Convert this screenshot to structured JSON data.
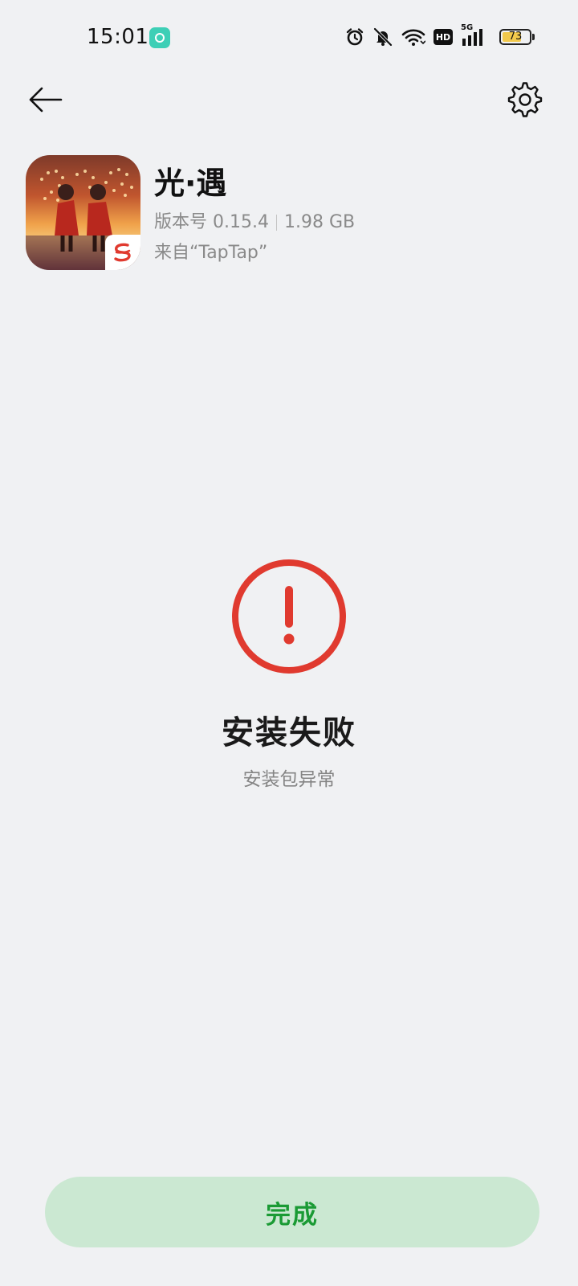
{
  "status_bar": {
    "time": "15:01",
    "battery_level": "73",
    "network": "5G",
    "hd_label": "HD",
    "icons": [
      "notification-app-icon",
      "alarm-icon",
      "mute-bell-icon",
      "wifi-icon",
      "hd-icon",
      "signal-5g-icon",
      "battery-icon"
    ]
  },
  "header": {
    "back_icon": "arrow-left-icon",
    "settings_icon": "gear-icon"
  },
  "app": {
    "name": "光·遇",
    "version": "版本号 0.15.4",
    "size": "1.98 GB",
    "source": "来自“TapTap”"
  },
  "result": {
    "icon": "exclamation-circle-icon",
    "icon_color": "#e03a2f",
    "title": "安装失败",
    "subtitle": "安装包异常"
  },
  "actions": {
    "done_label": "完成",
    "done_color": "#1a9a34",
    "done_background": "#cbe8d2"
  }
}
